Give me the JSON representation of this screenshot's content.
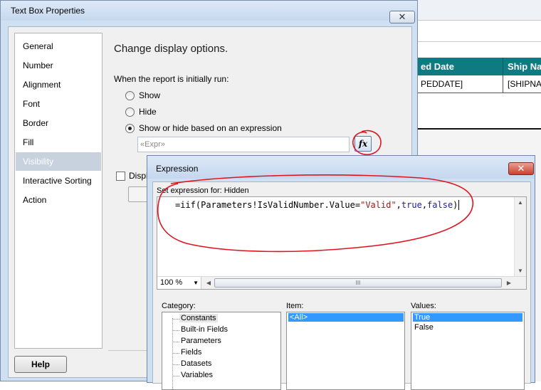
{
  "report": {
    "headers": [
      "ed Date",
      "Ship Na"
    ],
    "cells": [
      "PEDDATE]",
      "[SHIPNA"
    ],
    "header_color": "#0e7a82"
  },
  "text_box_properties": {
    "title": "Text Box Properties",
    "close_glyph": "✕",
    "nav_items": [
      "General",
      "Number",
      "Alignment",
      "Font",
      "Border",
      "Fill",
      "Visibility",
      "Interactive Sorting",
      "Action"
    ],
    "selected_nav": "Visibility",
    "heading": "Change display options.",
    "subheading": "When the report is initially run:",
    "radio_options": [
      "Show",
      "Hide",
      "Show or hide based on an expression"
    ],
    "selected_radio": "Show or hide based on an expression",
    "expression_placeholder": "«Expr»",
    "fx_label": "fx",
    "display_checkbox_label": "Displ",
    "help_label": "Help"
  },
  "expression_dialog": {
    "title": "Expression",
    "close_glyph": "✕",
    "set_expression_label": "Set expression for: Hidden",
    "code_prefix": "=iif(Parameters!IsValidNumber.Value=",
    "code_string": "\"Valid\"",
    "code_comma1": ",",
    "code_true": "true",
    "code_comma2": ",",
    "code_false": "false",
    "code_suffix": ")",
    "zoom": "100 %",
    "scroll_grip": "III",
    "category_label": "Category:",
    "item_label": "Item:",
    "values_label": "Values:",
    "categories": [
      "Constants",
      "Built-in Fields",
      "Parameters",
      "Fields",
      "Datasets",
      "Variables"
    ],
    "selected_category": "Constants",
    "items": [
      "<All>"
    ],
    "values": [
      "True",
      "False"
    ],
    "selected_value": "True",
    "annotation_color": "#e0141e"
  }
}
